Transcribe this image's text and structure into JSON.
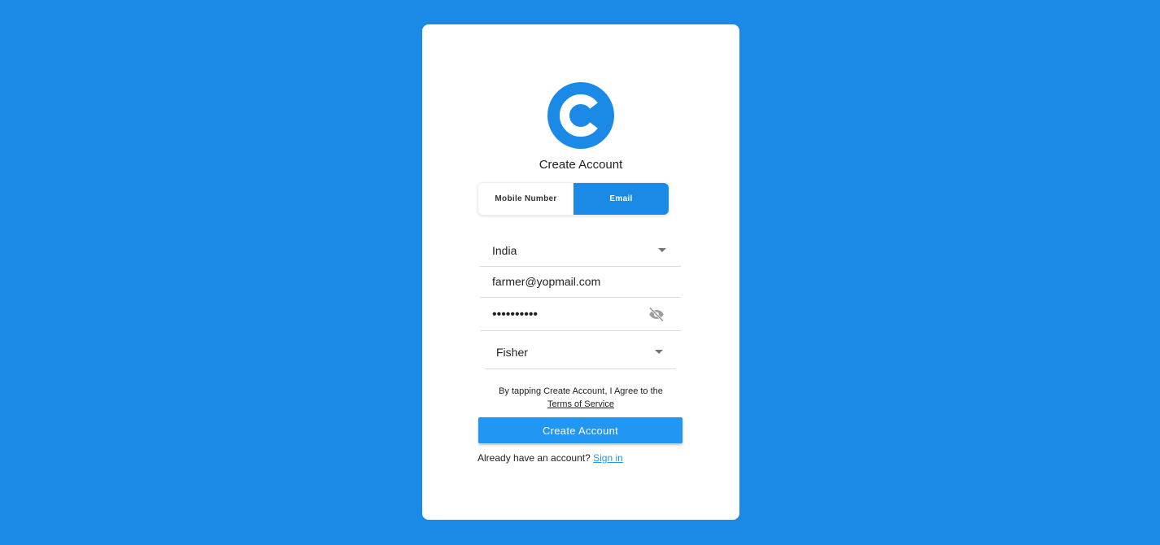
{
  "colors": {
    "background": "#1a8ae6",
    "accent": "#1a8ae6",
    "button": "#2196f3",
    "link": "#2196f3"
  },
  "logo": {
    "icon": "brand-c-logo-icon"
  },
  "title": "Create Account",
  "tabs": [
    {
      "label": "Mobile Number",
      "active": false
    },
    {
      "label": "Email",
      "active": true
    }
  ],
  "form": {
    "country": {
      "value": "India",
      "icon": "chevron-down-icon"
    },
    "email": {
      "value": "farmer@yopmail.com"
    },
    "password": {
      "value": "••••••••••",
      "icon": "eye-off-icon"
    },
    "role": {
      "value": "Fisher",
      "icon": "chevron-down-icon"
    }
  },
  "terms": {
    "text": "By tapping Create Account, I Agree to the",
    "link": "Terms of Service"
  },
  "submit_label": "Create Account",
  "signin": {
    "prompt": "Already have an account?",
    "link": "Sign in"
  }
}
